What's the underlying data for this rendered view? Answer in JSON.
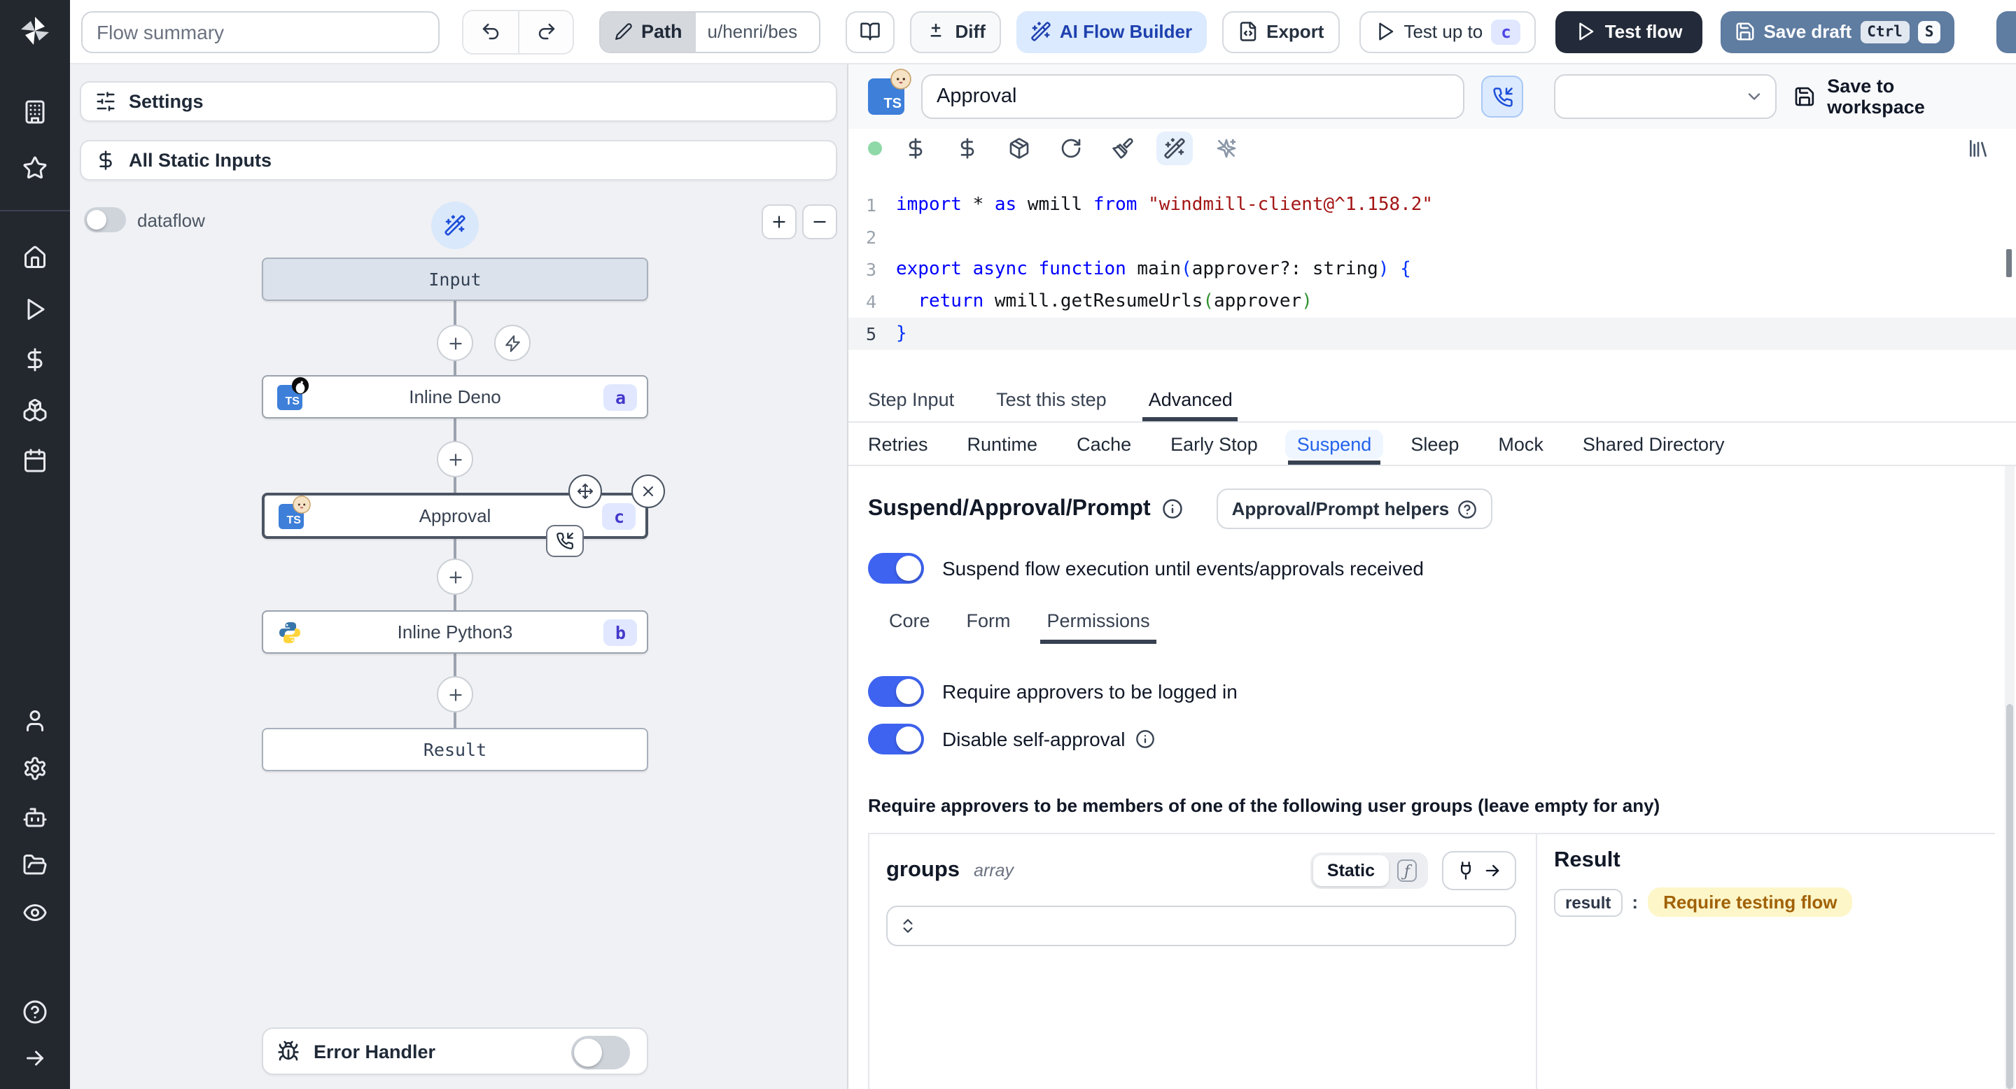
{
  "toolbar": {
    "flow_summary_placeholder": "Flow summary",
    "path_label": "Path",
    "path_value": "u/henri/bes",
    "diff_label": "Diff",
    "ai_flow_builder_label": "AI Flow Builder",
    "export_label": "Export",
    "test_up_to_label": "Test up to",
    "test_up_to_badge": "c",
    "test_flow_label": "Test flow",
    "save_draft_label": "Save draft",
    "save_draft_keys": [
      "Ctrl",
      "S"
    ]
  },
  "sidebar": {
    "icons": [
      "windmill-logo",
      "building-icon",
      "star-icon",
      "home-icon",
      "runs-play-icon",
      "variables-dollar-icon",
      "resources-boxes-icon",
      "schedules-calendar-icon",
      "user-icon",
      "settings-gear-icon",
      "workers-bot-icon",
      "folders-icon",
      "audit-eye-icon",
      "help-icon",
      "expand-arrow-icon"
    ]
  },
  "left_panel": {
    "settings_label": "Settings",
    "all_static_inputs_label": "All Static Inputs",
    "dataflow_label": "dataflow",
    "error_handler_label": "Error Handler",
    "graph": {
      "input_label": "Input",
      "result_label": "Result",
      "steps": [
        {
          "label": "Inline Deno",
          "badge": "a",
          "lang": "deno"
        },
        {
          "label": "Approval",
          "badge": "c",
          "lang": "bun"
        },
        {
          "label": "Inline Python3",
          "badge": "b",
          "lang": "python"
        }
      ]
    }
  },
  "right_panel": {
    "header": {
      "language_badge": "TS",
      "step_name": "Approval",
      "save_to_workspace_label": "Save to workspace"
    },
    "editor_icons": [
      "status-dot",
      "dollar-icon",
      "dollar-icon",
      "package-icon",
      "reload-icon",
      "paintbrush-icon",
      "wand-sparkles-icon",
      "sparkles-off-icon",
      "library-icon"
    ],
    "code": {
      "lines": [
        {
          "n": "1",
          "tokens": [
            [
              "kw",
              "import"
            ],
            [
              "pl",
              " * "
            ],
            [
              "kw",
              "as"
            ],
            [
              "pl",
              " wmill "
            ],
            [
              "kw",
              "from"
            ],
            [
              "pl",
              " "
            ],
            [
              "str",
              "\"windmill-client@^1.158.2\""
            ]
          ]
        },
        {
          "n": "2",
          "tokens": []
        },
        {
          "n": "3",
          "tokens": [
            [
              "kw",
              "export"
            ],
            [
              "pl",
              " "
            ],
            [
              "kw",
              "async"
            ],
            [
              "pl",
              " "
            ],
            [
              "kw",
              "function"
            ],
            [
              "pl",
              " main"
            ],
            [
              "b1",
              "("
            ],
            [
              "pl",
              "approver?: string"
            ],
            [
              "b1",
              ")"
            ],
            [
              "pl",
              " "
            ],
            [
              "b1",
              "{"
            ]
          ]
        },
        {
          "n": "4",
          "tokens": [
            [
              "pl",
              "  "
            ],
            [
              "kw",
              "return"
            ],
            [
              "pl",
              " wmill.getResumeUrls"
            ],
            [
              "b2",
              "("
            ],
            [
              "pl",
              "approver"
            ],
            [
              "b2",
              ")"
            ]
          ]
        },
        {
          "n": "5",
          "tokens": [
            [
              "b1",
              "}"
            ]
          ]
        }
      ]
    },
    "tabs": [
      "Step Input",
      "Test this step",
      "Advanced"
    ],
    "active_tab": "Advanced",
    "subtabs": [
      "Retries",
      "Runtime",
      "Cache",
      "Early Stop",
      "Suspend",
      "Sleep",
      "Mock",
      "Shared Directory"
    ],
    "active_subtab": "Suspend",
    "suspend": {
      "heading": "Suspend/Approval/Prompt",
      "helpers_label": "Approval/Prompt helpers",
      "suspend_toggle_label": "Suspend flow execution until events/approvals received",
      "perm_tabs": [
        "Core",
        "Form",
        "Permissions"
      ],
      "active_perm_tab": "Permissions",
      "logged_in_toggle_label": "Require approvers to be logged in",
      "self_approval_toggle_label": "Disable self-approval",
      "groups_note": "Require approvers to be members of one of the following user groups (leave empty for any)",
      "groups_label": "groups",
      "groups_type": "array",
      "static_label": "Static",
      "fn_symbol": "ƒ"
    },
    "result": {
      "heading": "Result",
      "key": "result",
      "colon": ":",
      "value": "Require testing flow"
    }
  },
  "colors": {
    "toggle_on": "#3e63f0",
    "ai_button_bg": "#dbeafe",
    "accent_blue": "#2563eb",
    "badge_bg": "#e0e7ff",
    "badge_text": "#4338ca",
    "result_highlight_bg": "#fdf6c9",
    "result_highlight_text": "#a16207",
    "sidebar_bg": "#23272e",
    "dark_button_bg": "#232b3a",
    "save_draft_bg": "#5f7ca1"
  }
}
